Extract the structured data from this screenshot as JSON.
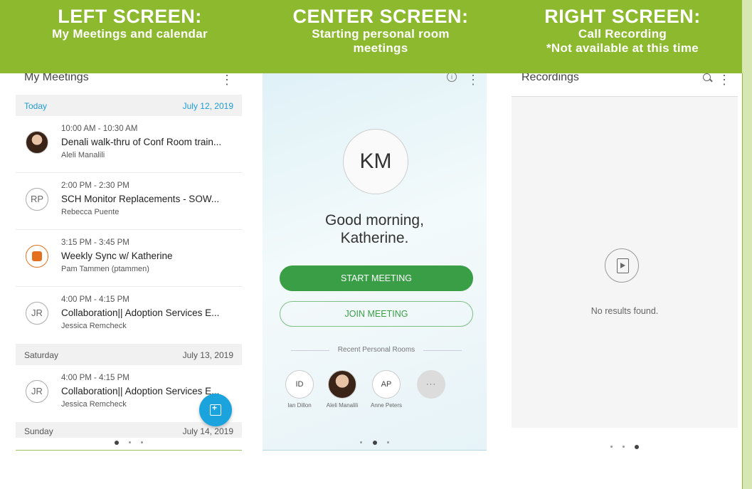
{
  "header": {
    "left": {
      "title": "LEFT SCREEN:",
      "subtitle": "My Meetings and calendar"
    },
    "center": {
      "title": "CENTER SCREEN:",
      "subtitle_line1": "Starting personal room",
      "subtitle_line2": "meetings"
    },
    "right": {
      "title": "RIGHT SCREEN:",
      "subtitle_line1": "Call Recording",
      "subtitle_line2": "*Not available at this time"
    }
  },
  "left_screen": {
    "app_title": "My Meetings",
    "days": [
      {
        "label": "Today",
        "date": "July 12, 2019"
      },
      {
        "label": "Saturday",
        "date": "July 13, 2019"
      },
      {
        "label": "Sunday",
        "date": "July 14, 2019"
      }
    ],
    "meetings": [
      {
        "time": "10:00 AM - 10:30 AM",
        "title": "Denali walk-thru of Conf Room train...",
        "host": "Aleli Manalili",
        "avatar": ""
      },
      {
        "time": "2:00 PM - 2:30 PM",
        "title": "SCH Monitor Replacements - SOW...",
        "host": "Rebecca Puente",
        "avatar": "RP"
      },
      {
        "time": "3:15 PM - 3:45 PM",
        "title": "Weekly Sync w/ Katherine",
        "host": "Pam Tammen (ptammen)",
        "avatar": ""
      },
      {
        "time": "4:00 PM - 4:15 PM",
        "title": "Collaboration|| Adoption Services E...",
        "host": "Jessica Remcheck",
        "avatar": "JR"
      },
      {
        "time": "4:00 PM - 4:15 PM",
        "title": "Collaboration|| Adoption Services E...",
        "host": "Jessica Remcheck",
        "avatar": "JR"
      }
    ],
    "page_indicator": {
      "total": 3,
      "active": 1
    }
  },
  "center_screen": {
    "initials": "KM",
    "greeting_line1": "Good morning,",
    "greeting_line2": "Katherine.",
    "start_label": "START MEETING",
    "join_label": "JOIN MEETING",
    "recent_label": "Recent Personal Rooms",
    "rooms": [
      {
        "initials": "ID",
        "name": "Ian Dillon"
      },
      {
        "initials": "",
        "name": "Aleli Manalili"
      },
      {
        "initials": "AP",
        "name": "Anne Peters"
      },
      {
        "initials": "···",
        "name": ""
      }
    ],
    "page_indicator": {
      "total": 3,
      "active": 2
    }
  },
  "right_screen": {
    "app_title": "Recordings",
    "empty_text": "No results found.",
    "page_indicator": {
      "total": 3,
      "active": 3
    }
  },
  "colors": {
    "header_green": "#8db92e",
    "accent_blue": "#1e9bd7",
    "meeting_green": "#3a9e47",
    "meeting_orange": "#e46f1c"
  }
}
